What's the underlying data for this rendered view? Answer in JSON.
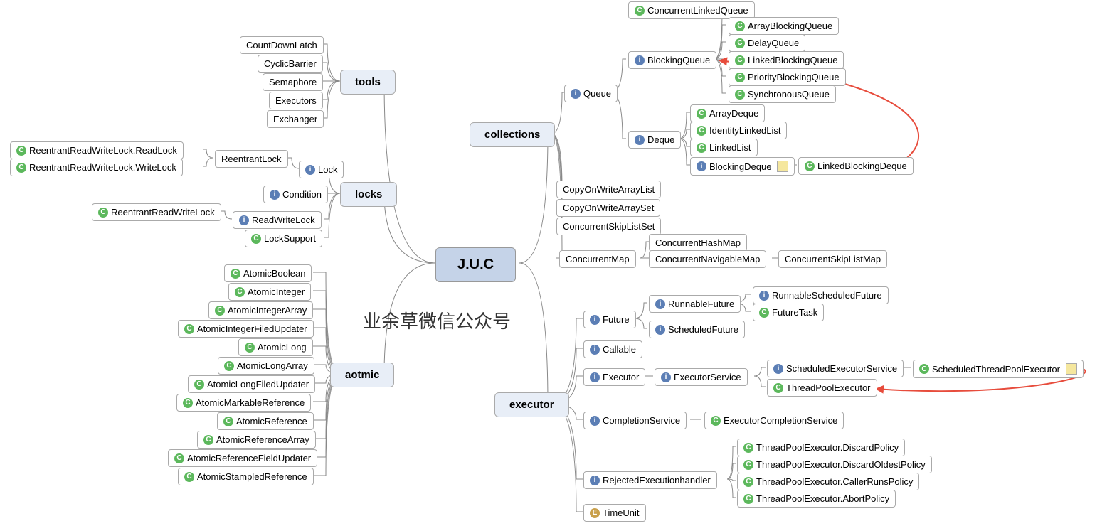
{
  "root": "J.U.C",
  "subtitle": "业余草微信公众号",
  "branches": {
    "tools": "tools",
    "locks": "locks",
    "atomic": "aotmic",
    "collections": "collections",
    "executor": "executor"
  },
  "tools_items": [
    "CountDownLatch",
    "CyclicBarrier",
    "Semaphore",
    "Executors",
    "Exchanger"
  ],
  "locks": {
    "lock": "Lock",
    "condition": "Condition",
    "readwrite": "ReadWriteLock",
    "support": "LockSupport",
    "reentrant": "ReentrantLock",
    "readlock": "ReentrantReadWriteLock.ReadLock",
    "writelock": "ReentrantReadWriteLock.WriteLock",
    "rwlock": "ReentrantReadWriteLock"
  },
  "atomic_items": [
    "AtomicBoolean",
    "AtomicInteger",
    "AtomicIntegerArray",
    "AtomicIntegerFiledUpdater",
    "AtomicLong",
    "AtomicLongArray",
    "AtomicLongFiledUpdater",
    "AtomicMarkableReference",
    "AtomicReference",
    "AtomicReferenceArray",
    "AtomicReferenceFieldUpdater",
    "AtomicStampledReference"
  ],
  "collections": {
    "queue": "Queue",
    "deque": "Deque",
    "blockingqueue": "BlockingQueue",
    "blockingdeque": "BlockingDeque",
    "linkedblockingdeque": "LinkedBlockingDeque",
    "clq": "ConcurrentLinkedQueue",
    "bq_items": [
      "ArrayBlockingQueue",
      "DelayQueue",
      "LinkedBlockingQueue",
      "PriorityBlockingQueue",
      "SynchronousQueue"
    ],
    "deque_items": [
      "ArrayDeque",
      "IdentityLinkedList",
      "LinkedList"
    ],
    "cow_items": [
      "CopyOnWriteArrayList",
      "CopyOnWriteArraySet",
      "ConcurrentSkipListSet"
    ],
    "concurrentmap": "ConcurrentMap",
    "chm": "ConcurrentHashMap",
    "cnm": "ConcurrentNavigableMap",
    "cslm": "ConcurrentSkipListMap"
  },
  "executor": {
    "future": "Future",
    "callable": "Callable",
    "executor": "Executor",
    "completionservice": "CompletionService",
    "rej": "RejectedExecutionhandler",
    "timeunit": "TimeUnit",
    "runnablefuture": "RunnableFuture",
    "scheduledfuture": "ScheduledFuture",
    "rsf": "RunnableScheduledFuture",
    "futuretask": "FutureTask",
    "executorservice": "ExecutorService",
    "ses": "ScheduledExecutorService",
    "tpe": "ThreadPoolExecutor",
    "stpe": "ScheduledThreadPoolExecutor",
    "ecs": "ExecutorCompletionService",
    "rej_items": [
      "ThreadPoolExecutor.DiscardPolicy",
      "ThreadPoolExecutor.DiscardOldestPolicy",
      "ThreadPoolExecutor.CallerRunsPolicy",
      "ThreadPoolExecutor.AbortPolicy"
    ]
  }
}
